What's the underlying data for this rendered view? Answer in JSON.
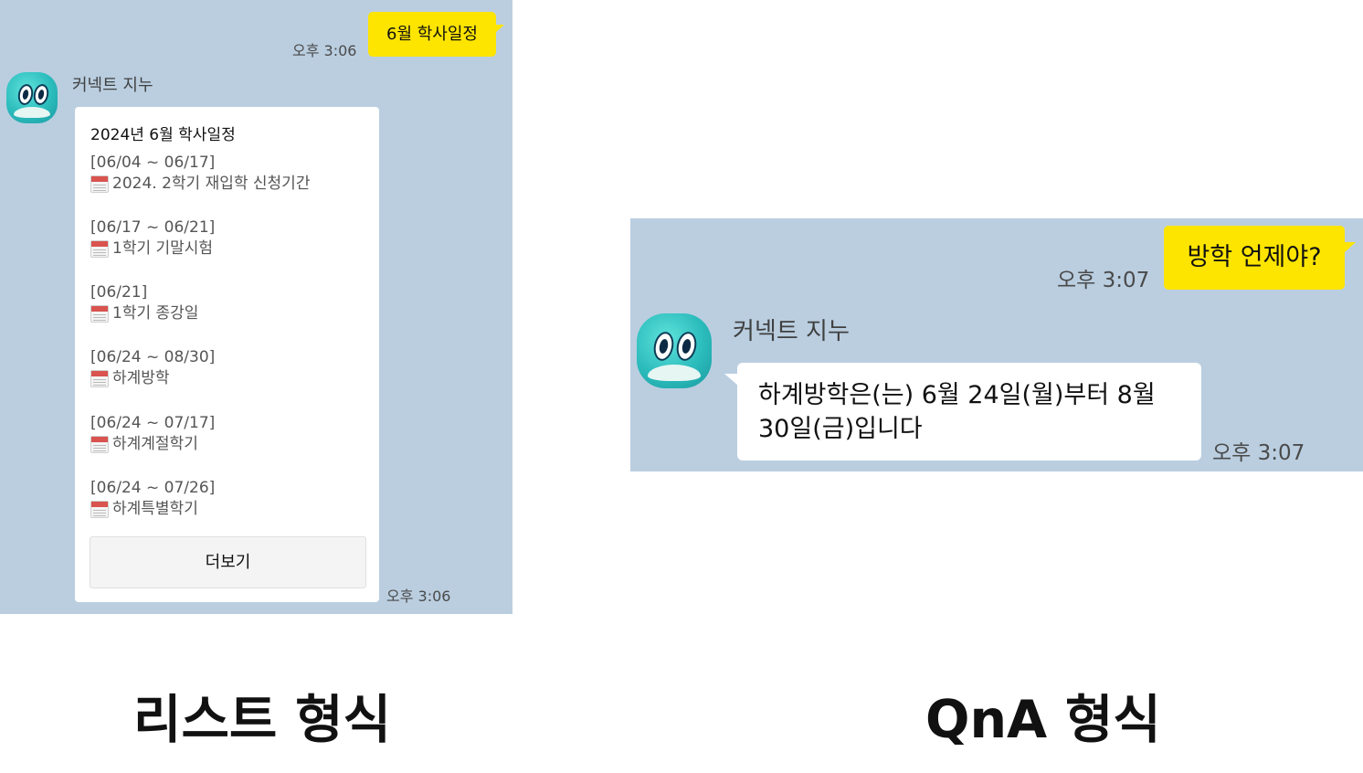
{
  "list_example": {
    "user_message": "6월 학사일정",
    "user_time": "오후 3:06",
    "bot_name": "커넥트 지누",
    "card_title": "2024년 6월 학사일정",
    "entries": [
      {
        "date": "[06/04 ~ 06/17]",
        "text": "2024. 2학기 재입학 신청기간"
      },
      {
        "date": "[06/17 ~ 06/21]",
        "text": "1학기 기말시험"
      },
      {
        "date": "[06/21]",
        "text": "1학기 종강일"
      },
      {
        "date": "[06/24 ~ 08/30]",
        "text": "하계방학"
      },
      {
        "date": "[06/24 ~ 07/17]",
        "text": "하계계절학기"
      },
      {
        "date": "[06/24 ~ 07/26]",
        "text": "하계특별학기"
      }
    ],
    "more_button": "더보기",
    "bot_time": "오후 3:06"
  },
  "qna_example": {
    "user_message": "방학 언제야?",
    "user_time": "오후 3:07",
    "bot_name": "커넥트 지누",
    "answer": "하계방학은(는) 6월 24일(월)부터 8월 30일(금)입니다",
    "bot_time": "오후 3:07"
  },
  "captions": {
    "left": "리스트 형식",
    "right": "QnA 형식"
  },
  "colors": {
    "chat_background": "#bacee0",
    "user_bubble": "#fee500",
    "bot_bubble": "#ffffff",
    "avatar": "#2cbcbc"
  },
  "icons": {
    "avatar": "chatbot-avatar-icon",
    "entry_icon": "calendar-icon"
  }
}
